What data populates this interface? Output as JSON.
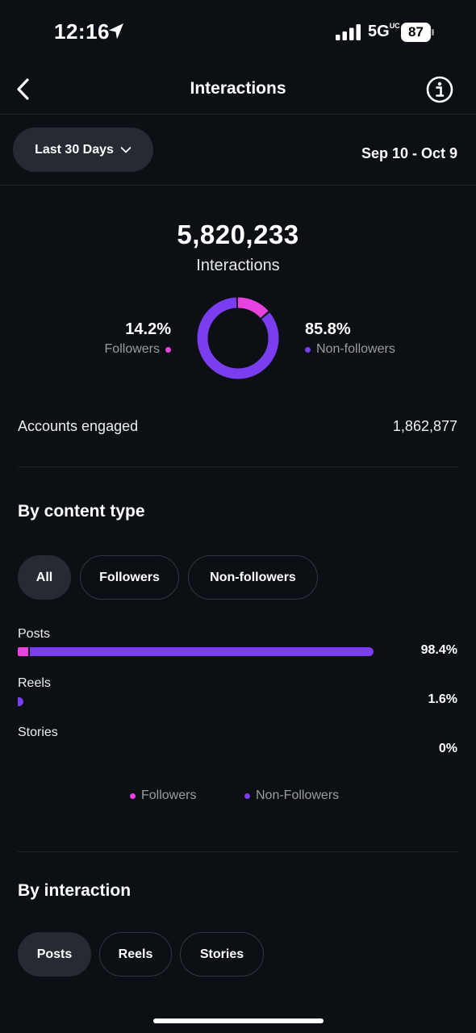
{
  "status_bar": {
    "time": "12:16",
    "network": "5G",
    "network_suffix": "UC",
    "battery": "87"
  },
  "header": {
    "title": "Interactions"
  },
  "filter": {
    "range_label": "Last 30 Days",
    "dates": "Sep 10 - Oct 9"
  },
  "summary": {
    "total": "5,820,233",
    "total_label": "Interactions",
    "followers_pct": "14.2%",
    "followers_label": "Followers",
    "non_followers_pct": "85.8%",
    "non_followers_label": "Non-followers",
    "donut_followers_fraction": 0.142,
    "accounts_engaged_label": "Accounts engaged",
    "accounts_engaged_value": "1,862,877"
  },
  "colors": {
    "followers": "#e843e0",
    "non_followers": "#7a3df0",
    "background": "#0c0f14"
  },
  "content_type": {
    "title": "By content type",
    "chips": [
      "All",
      "Followers",
      "Non-followers"
    ],
    "active_chip": "All",
    "rows": [
      {
        "label": "Posts",
        "pct": "98.4%",
        "value": 98.4,
        "followers_fraction": 0.03
      },
      {
        "label": "Reels",
        "pct": "1.6%",
        "value": 1.6,
        "followers_fraction": 0.0
      },
      {
        "label": "Stories",
        "pct": "0%",
        "value": 0,
        "followers_fraction": 0.0
      }
    ],
    "legend": [
      "Followers",
      "Non-Followers"
    ]
  },
  "interaction": {
    "title": "By interaction",
    "chips": [
      "Posts",
      "Reels",
      "Stories"
    ],
    "active_chip": "Posts"
  },
  "icons": [
    "location-arrow-icon",
    "cellular-signal-icon",
    "battery-icon",
    "back-chevron-icon",
    "info-icon",
    "chevron-down-icon"
  ]
}
